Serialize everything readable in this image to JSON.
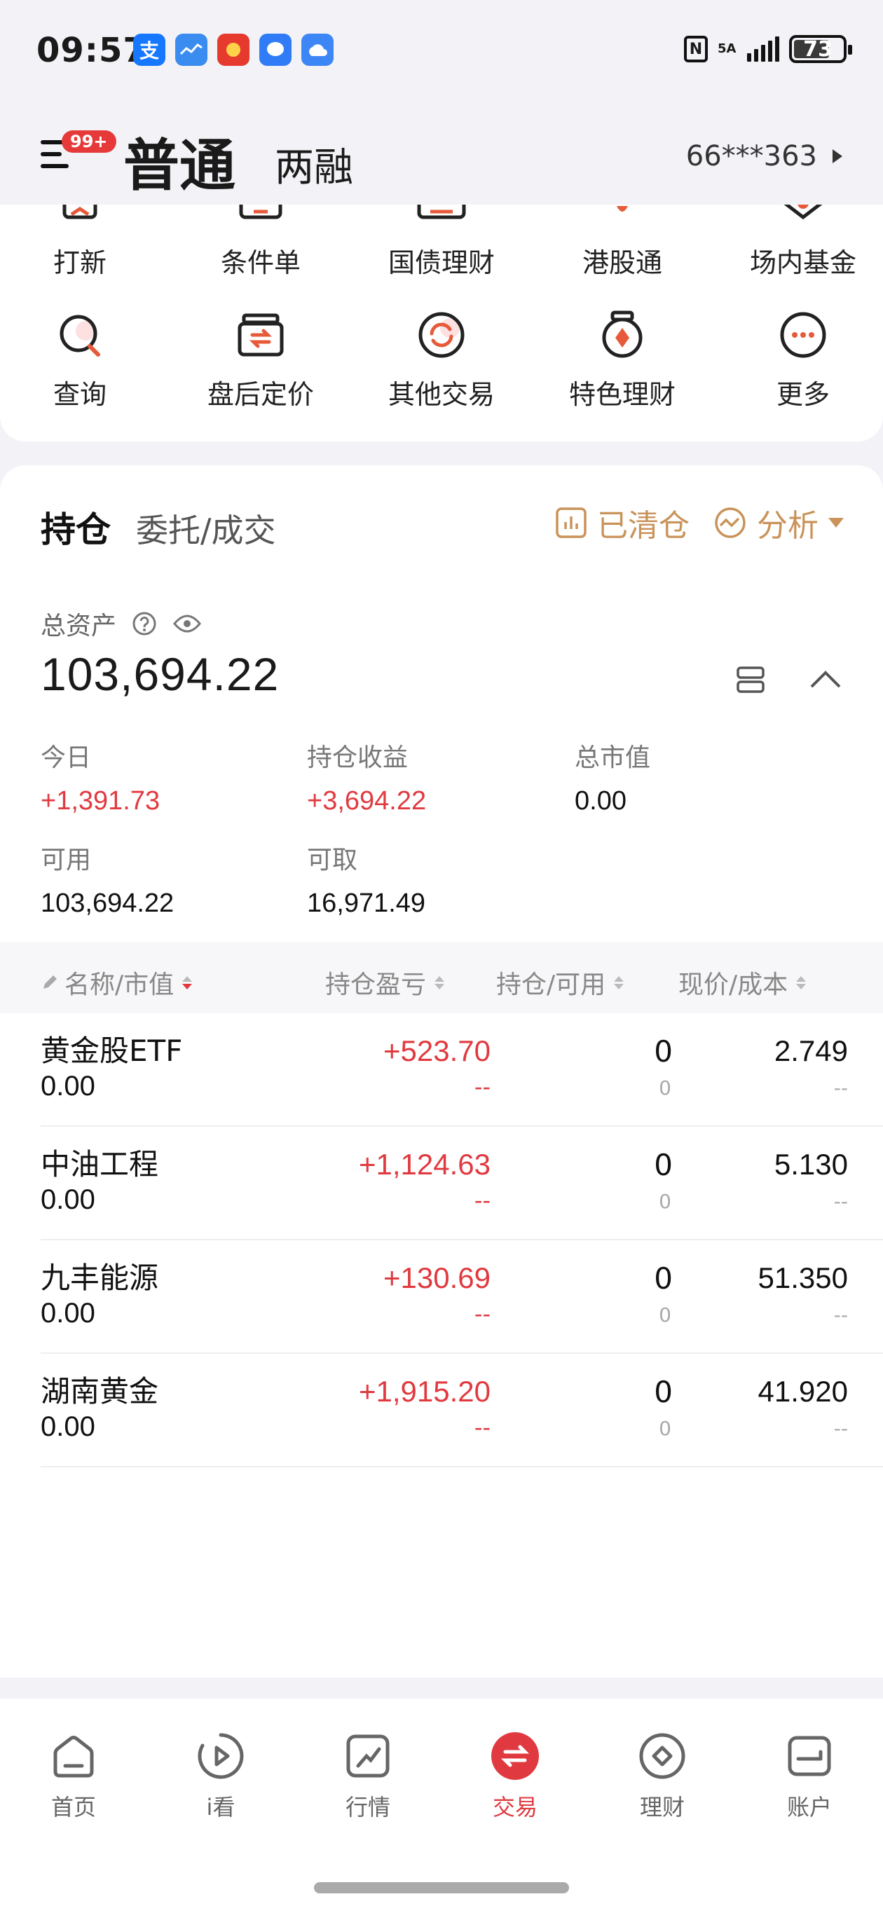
{
  "status_bar": {
    "time": "09:57",
    "network": "5A",
    "battery": "73",
    "app_icons": [
      "alipay-icon",
      "stock-chart-app-icon",
      "red-envelope-app-icon",
      "message-app-icon",
      "cloud-app-icon"
    ]
  },
  "header": {
    "badge": "99+",
    "mode_active": "普通",
    "mode_inactive": "两融",
    "account": "66***363"
  },
  "functions": {
    "row1": [
      "打新",
      "条件单",
      "国债理财",
      "港股通",
      "场内基金"
    ],
    "row2": [
      "查询",
      "盘后定价",
      "其他交易",
      "特色理财",
      "更多"
    ]
  },
  "holdings": {
    "tab_active": "持仓",
    "tab_other": "委托/成交",
    "action_cleared": "已清仓",
    "action_analysis": "分析",
    "total_assets_label": "总资产",
    "total_assets": "103,694.22",
    "metrics": {
      "today_label": "今日",
      "today_value": "+1,391.73",
      "position_profit_label": "持仓收益",
      "position_profit_value": "+3,694.22",
      "market_value_label": "总市值",
      "market_value_value": "0.00",
      "available_label": "可用",
      "available_value": "103,694.22",
      "withdrawable_label": "可取",
      "withdrawable_value": "16,971.49"
    },
    "columns": [
      "名称/市值",
      "持仓盈亏",
      "持仓/可用",
      "现价/成本"
    ],
    "rows": [
      {
        "name": "黄金股ETF",
        "market_value": "0.00",
        "pnl": "+523.70",
        "pnl_pct": "--",
        "qty": "0",
        "avail": "0",
        "price": "2.749",
        "cost": "--"
      },
      {
        "name": "中油工程",
        "market_value": "0.00",
        "pnl": "+1,124.63",
        "pnl_pct": "--",
        "qty": "0",
        "avail": "0",
        "price": "5.130",
        "cost": "--"
      },
      {
        "name": "九丰能源",
        "market_value": "0.00",
        "pnl": "+130.69",
        "pnl_pct": "--",
        "qty": "0",
        "avail": "0",
        "price": "51.350",
        "cost": "--"
      },
      {
        "name": "湖南黄金",
        "market_value": "0.00",
        "pnl": "+1,915.20",
        "pnl_pct": "--",
        "qty": "0",
        "avail": "0",
        "price": "41.920",
        "cost": "--"
      }
    ]
  },
  "bottom_nav": [
    {
      "label": "首页",
      "icon": "home-icon"
    },
    {
      "label": "i看",
      "icon": "play-icon"
    },
    {
      "label": "行情",
      "icon": "trend-icon"
    },
    {
      "label": "交易",
      "icon": "trade-icon"
    },
    {
      "label": "理财",
      "icon": "wealth-icon"
    },
    {
      "label": "账户",
      "icon": "account-icon"
    }
  ],
  "colors": {
    "accent_red": "#e03a40",
    "gold": "#c9935a",
    "background": "#f3f3f7"
  }
}
